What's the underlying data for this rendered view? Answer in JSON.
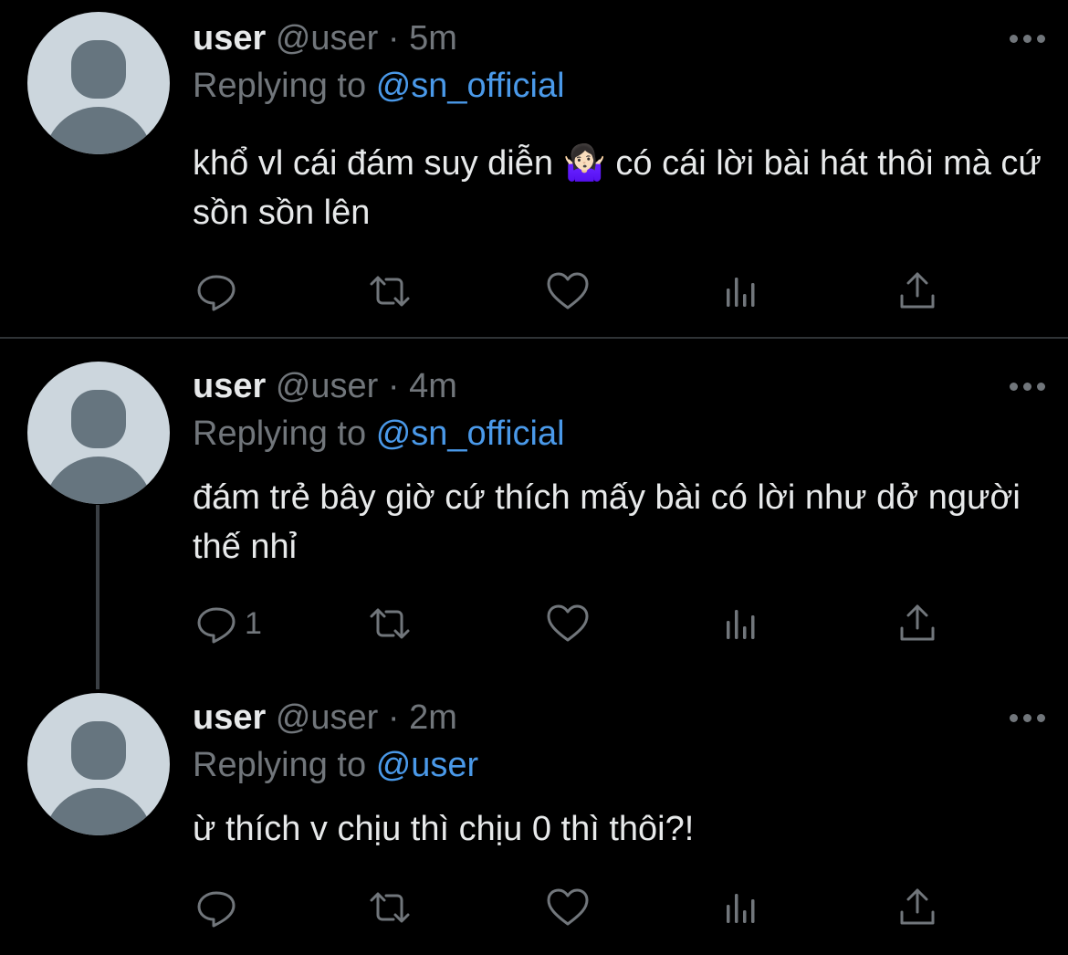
{
  "tweets": [
    {
      "name": "user",
      "handle": "@user",
      "dot": "·",
      "time": "5m",
      "replying_label": "Replying to",
      "mention": "@sn_official",
      "text": "khổ vl cái đám suy diễn 🤷🏻‍♀️  có cái lời bài hát thôi mà cứ sồn sồn lên",
      "reply_count": ""
    },
    {
      "name": "user",
      "handle": "@user",
      "dot": "·",
      "time": "4m",
      "replying_label": "Replying to",
      "mention": "@sn_official",
      "text": "đám trẻ bây giờ cứ thích mấy bài có lời như dở người thế nhỉ",
      "reply_count": "1"
    },
    {
      "name": "user",
      "handle": "@user",
      "dot": "·",
      "time": "2m",
      "replying_label": "Replying to",
      "mention": "@user",
      "text": "ừ thích v chịu thì chịu 0 thì thôi?!",
      "reply_count": ""
    }
  ],
  "colors": {
    "background": "#000000",
    "text": "#e7e9ea",
    "muted": "#71767b",
    "mention": "#4a99e9",
    "avatar_bg": "#ccd6dd",
    "avatar_fg": "#66757f"
  },
  "icons": [
    "reply-icon",
    "retweet-icon",
    "like-icon",
    "views-icon",
    "share-icon",
    "more-icon"
  ]
}
